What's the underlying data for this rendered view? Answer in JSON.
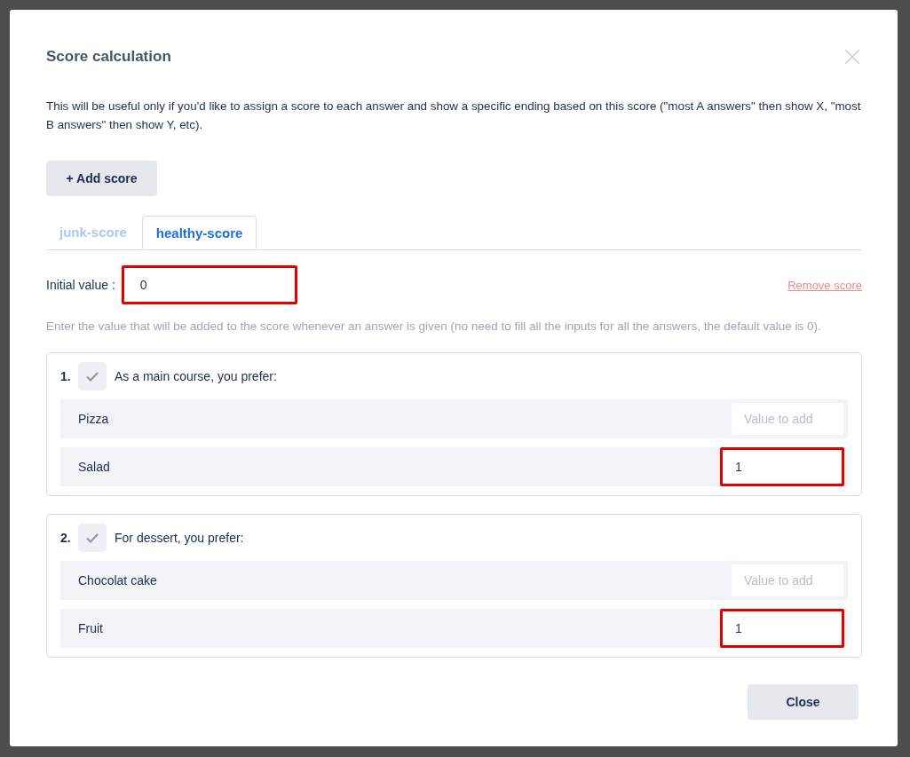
{
  "dialog": {
    "title": "Score calculation",
    "description": "This will be useful only if you'd like to assign a score to each answer and show a specific ending based on this score (\"most A answers\" then show X, \"most B answers\" then show Y, etc).",
    "add_button": "+ Add score",
    "tabs": [
      {
        "label": "junk-score",
        "selected": false
      },
      {
        "label": "healthy-score",
        "selected": true
      }
    ],
    "initial_value": {
      "label": "Initial value :",
      "value": "0",
      "highlighted": true
    },
    "remove_link": "Remove score",
    "hint": "Enter the value that will be added to the score whenever an answer is given (no need to fill all the inputs for all the answers, the default value is 0).",
    "questions": [
      {
        "number": "1.",
        "text": "As a main course, you prefer:",
        "answers": [
          {
            "label": "Pizza",
            "placeholder": "Value to add",
            "highlighted": false
          },
          {
            "label": "Salad",
            "value": "1",
            "highlighted": true
          }
        ]
      },
      {
        "number": "2.",
        "text": "For dessert, you prefer:",
        "answers": [
          {
            "label": "Chocolat cake",
            "placeholder": "Value to add",
            "highlighted": false
          },
          {
            "label": "Fruit",
            "value": "1",
            "highlighted": true
          }
        ]
      }
    ],
    "close_button": "Close"
  }
}
